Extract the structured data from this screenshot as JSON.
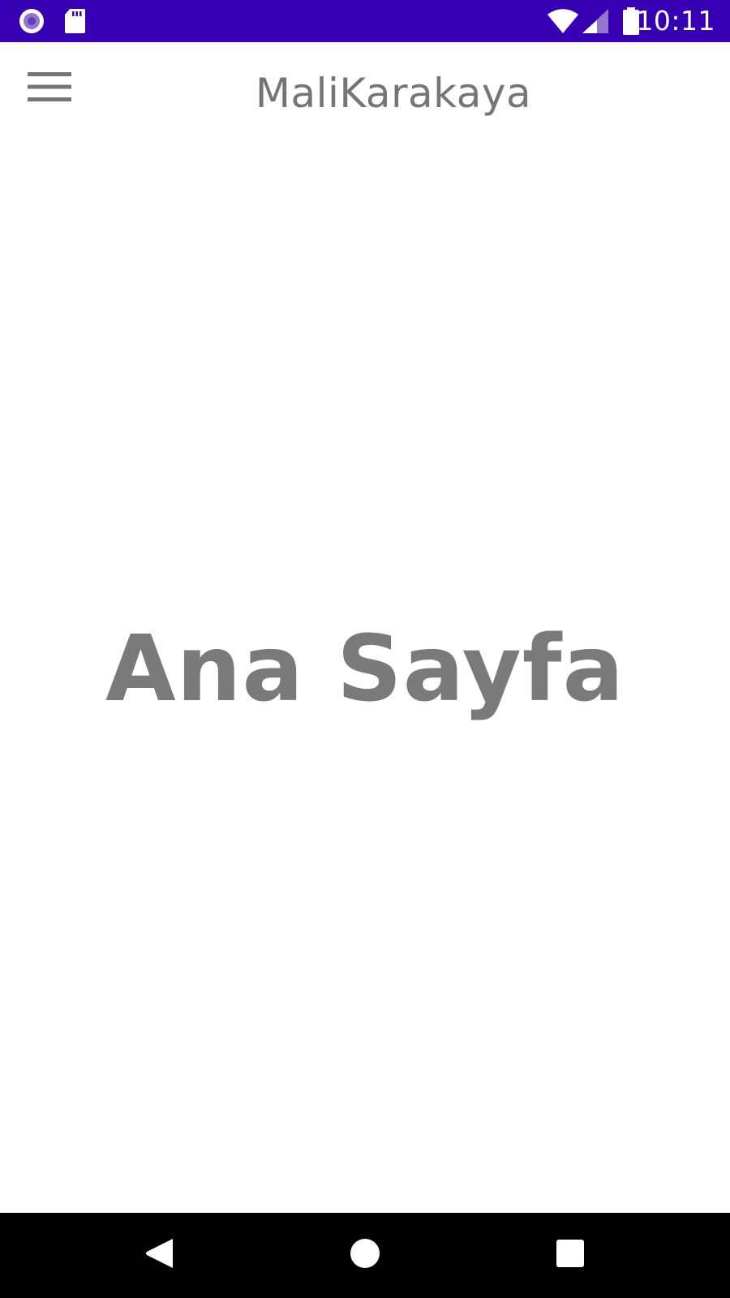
{
  "status_bar": {
    "time": "10:11",
    "background_color": "#3700b3",
    "left_icons": [
      "radio-record-icon",
      "sd-card-icon"
    ],
    "right_icons": [
      "wifi-icon",
      "signal-icon",
      "battery-icon"
    ]
  },
  "app_bar": {
    "title": "MaliKarakaya",
    "menu_icon": "hamburger-menu-icon"
  },
  "main": {
    "heading": "Ana Sayfa"
  },
  "nav_bar": {
    "buttons": [
      "back-icon",
      "home-icon",
      "recents-icon"
    ]
  },
  "colors": {
    "primary_dark": "#3700b3",
    "text_gray": "#757575",
    "nav_background": "#000000"
  }
}
